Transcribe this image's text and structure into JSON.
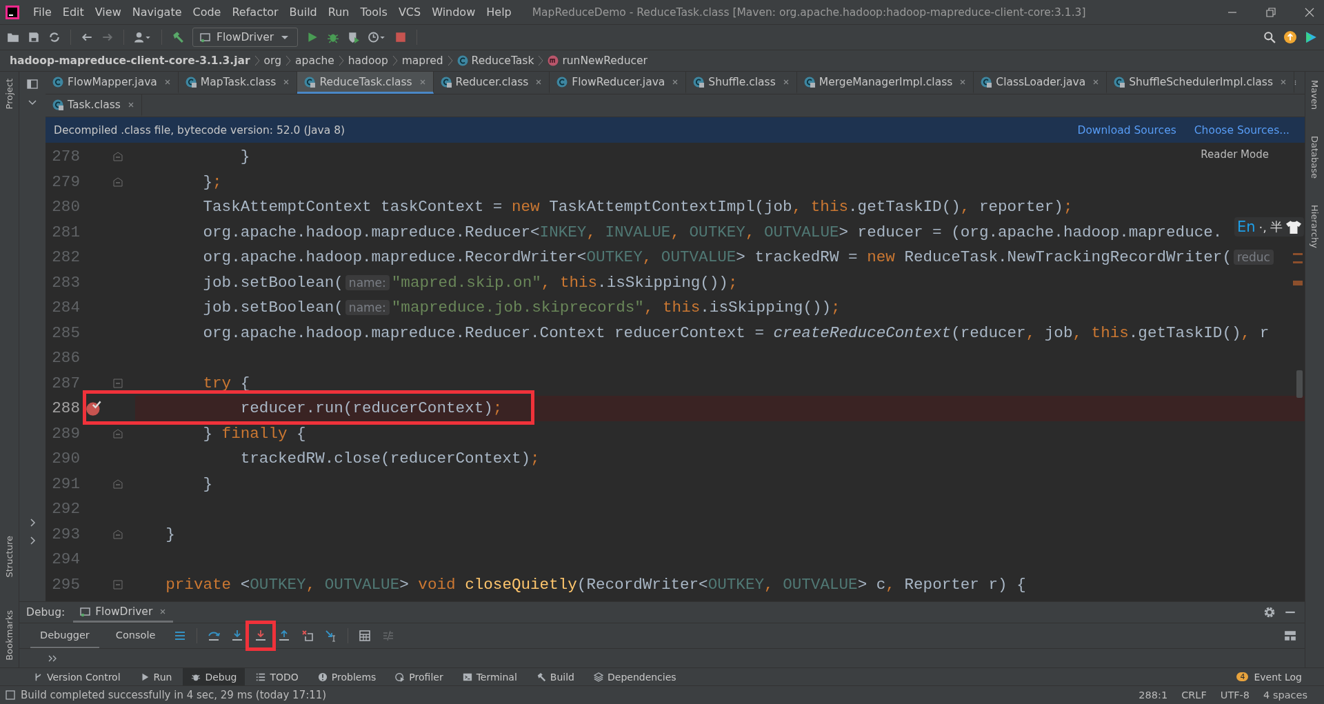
{
  "title_bar": {
    "menu": [
      "File",
      "Edit",
      "View",
      "Navigate",
      "Code",
      "Refactor",
      "Build",
      "Run",
      "Tools",
      "VCS",
      "Window",
      "Help"
    ],
    "title": "MapReduceDemo - ReduceTask.class [Maven: org.apache.hadoop:hadoop-mapreduce-client-core:3.1.3]"
  },
  "toolbar": {
    "run_config": "FlowDriver"
  },
  "breadcrumbs": [
    {
      "label": "hadoop-mapreduce-client-core-3.1.3.jar",
      "kind": "jar"
    },
    {
      "label": "org",
      "kind": "package"
    },
    {
      "label": "apache",
      "kind": "package"
    },
    {
      "label": "hadoop",
      "kind": "package"
    },
    {
      "label": "mapred",
      "kind": "package"
    },
    {
      "label": "ReduceTask",
      "kind": "class"
    },
    {
      "label": "runNewReducer",
      "kind": "method"
    }
  ],
  "tab_rows": [
    [
      {
        "label": "FlowMapper.java",
        "kind": "source",
        "selected": false
      },
      {
        "label": "MapTask.class",
        "kind": "compiled",
        "selected": false
      },
      {
        "label": "ReduceTask.class",
        "kind": "compiled",
        "selected": true
      },
      {
        "label": "Reducer.class",
        "kind": "compiled",
        "selected": false
      },
      {
        "label": "FlowReducer.java",
        "kind": "source",
        "selected": false
      },
      {
        "label": "Shuffle.class",
        "kind": "compiled",
        "selected": false
      },
      {
        "label": "MergeManagerImpl.class",
        "kind": "compiled",
        "selected": false
      },
      {
        "label": "ClassLoader.java",
        "kind": "compiled",
        "selected": false
      },
      {
        "label": "ShuffleSchedulerImpl.class",
        "kind": "compiled",
        "selected": false
      }
    ],
    [
      {
        "label": "Task.class",
        "kind": "compiled",
        "selected": false
      }
    ]
  ],
  "banner": {
    "text": "Decompiled .class file, bytecode version: 52.0 (Java 8)",
    "links": [
      "Download Sources",
      "Choose Sources..."
    ]
  },
  "editor": {
    "reader_mode": "Reader Mode",
    "lines": [
      {
        "number": "278",
        "fold_start": false,
        "fold_end": true,
        "breakpoint": false,
        "highlighted": false,
        "tokens": [
          {
            "kind": "plain",
            "text": "            }"
          }
        ]
      },
      {
        "number": "279",
        "fold_start": false,
        "fold_end": true,
        "breakpoint": false,
        "highlighted": false,
        "tokens": [
          {
            "kind": "plain",
            "text": "        }"
          },
          {
            "kind": "punct",
            "text": ";"
          }
        ]
      },
      {
        "number": "280",
        "fold_start": false,
        "fold_end": false,
        "breakpoint": false,
        "highlighted": false,
        "tokens": [
          {
            "kind": "plain",
            "text": "        TaskAttemptContext taskContext = "
          },
          {
            "kind": "keyword",
            "text": "new"
          },
          {
            "kind": "plain",
            "text": " TaskAttemptContextImpl(job"
          },
          {
            "kind": "punct",
            "text": ", "
          },
          {
            "kind": "keyword",
            "text": "this"
          },
          {
            "kind": "plain",
            "text": ".getTaskID()"
          },
          {
            "kind": "punct",
            "text": ", "
          },
          {
            "kind": "plain",
            "text": "reporter)"
          },
          {
            "kind": "punct",
            "text": ";"
          }
        ]
      },
      {
        "number": "281",
        "fold_start": false,
        "fold_end": false,
        "breakpoint": false,
        "highlighted": false,
        "tokens": [
          {
            "kind": "plain",
            "text": "        org.apache.hadoop.mapreduce.Reducer<"
          },
          {
            "kind": "typeparam",
            "text": "INKEY"
          },
          {
            "kind": "punct",
            "text": ", "
          },
          {
            "kind": "typeparam",
            "text": "INVALUE"
          },
          {
            "kind": "punct",
            "text": ", "
          },
          {
            "kind": "typeparam",
            "text": "OUTKEY"
          },
          {
            "kind": "punct",
            "text": ", "
          },
          {
            "kind": "typeparam",
            "text": "OUTVALUE"
          },
          {
            "kind": "plain",
            "text": "> reducer = (org.apache.hadoop.mapreduce."
          }
        ]
      },
      {
        "number": "282",
        "fold_start": false,
        "fold_end": false,
        "breakpoint": false,
        "highlighted": false,
        "tokens": [
          {
            "kind": "plain",
            "text": "        org.apache.hadoop.mapreduce.RecordWriter<"
          },
          {
            "kind": "typeparam",
            "text": "OUTKEY"
          },
          {
            "kind": "punct",
            "text": ", "
          },
          {
            "kind": "typeparam",
            "text": "OUTVALUE"
          },
          {
            "kind": "plain",
            "text": "> trackedRW = "
          },
          {
            "kind": "keyword",
            "text": "new"
          },
          {
            "kind": "plain",
            "text": " ReduceTask.NewTrackingRecordWriter("
          },
          {
            "kind": "hint",
            "text": "reduc"
          }
        ]
      },
      {
        "number": "283",
        "fold_start": false,
        "fold_end": false,
        "breakpoint": false,
        "highlighted": false,
        "tokens": [
          {
            "kind": "plain",
            "text": "        job.setBoolean("
          },
          {
            "kind": "hint",
            "text": "name:"
          },
          {
            "kind": "string",
            "text": "\"mapred.skip.on\""
          },
          {
            "kind": "punct",
            "text": ", "
          },
          {
            "kind": "keyword",
            "text": "this"
          },
          {
            "kind": "plain",
            "text": ".isSkipping())"
          },
          {
            "kind": "punct",
            "text": ";"
          }
        ]
      },
      {
        "number": "284",
        "fold_start": false,
        "fold_end": false,
        "breakpoint": false,
        "highlighted": false,
        "tokens": [
          {
            "kind": "plain",
            "text": "        job.setBoolean("
          },
          {
            "kind": "hint",
            "text": "name:"
          },
          {
            "kind": "string",
            "text": "\"mapreduce.job.skiprecords\""
          },
          {
            "kind": "punct",
            "text": ", "
          },
          {
            "kind": "keyword",
            "text": "this"
          },
          {
            "kind": "plain",
            "text": ".isSkipping())"
          },
          {
            "kind": "punct",
            "text": ";"
          }
        ]
      },
      {
        "number": "285",
        "fold_start": false,
        "fold_end": false,
        "breakpoint": false,
        "highlighted": false,
        "tokens": [
          {
            "kind": "plain",
            "text": "        org.apache.hadoop.mapreduce.Reducer.Context reducerContext = "
          },
          {
            "kind": "italic",
            "text": "createReduceContext"
          },
          {
            "kind": "plain",
            "text": "(reducer"
          },
          {
            "kind": "punct",
            "text": ", "
          },
          {
            "kind": "plain",
            "text": "job"
          },
          {
            "kind": "punct",
            "text": ", "
          },
          {
            "kind": "keyword",
            "text": "this"
          },
          {
            "kind": "plain",
            "text": ".getTaskID()"
          },
          {
            "kind": "punct",
            "text": ", "
          },
          {
            "kind": "plain",
            "text": "r"
          }
        ]
      },
      {
        "number": "286",
        "fold_start": false,
        "fold_end": false,
        "breakpoint": false,
        "highlighted": false
      },
      {
        "number": "287",
        "fold_start": true,
        "fold_end": false,
        "breakpoint": false,
        "highlighted": false,
        "tokens": [
          {
            "kind": "keyword",
            "text": "        try"
          },
          {
            "kind": "plain",
            "text": " {"
          }
        ]
      },
      {
        "number": "288",
        "fold_start": false,
        "fold_end": false,
        "breakpoint": true,
        "highlighted": true,
        "tokens": [
          {
            "kind": "plain",
            "text": "            reducer.run(reducerContext)"
          },
          {
            "kind": "punct",
            "text": ";"
          }
        ]
      },
      {
        "number": "289",
        "fold_start": false,
        "fold_end": true,
        "breakpoint": false,
        "highlighted": false,
        "tokens": [
          {
            "kind": "plain",
            "text": "        } "
          },
          {
            "kind": "keyword",
            "text": "finally"
          },
          {
            "kind": "plain",
            "text": " {"
          }
        ]
      },
      {
        "number": "290",
        "fold_start": false,
        "fold_end": false,
        "breakpoint": false,
        "highlighted": false,
        "tokens": [
          {
            "kind": "plain",
            "text": "            trackedRW.close(reducerContext)"
          },
          {
            "kind": "punct",
            "text": ";"
          }
        ]
      },
      {
        "number": "291",
        "fold_start": false,
        "fold_end": true,
        "breakpoint": false,
        "highlighted": false,
        "tokens": [
          {
            "kind": "plain",
            "text": "        }"
          }
        ]
      },
      {
        "number": "292",
        "fold_start": false,
        "fold_end": false,
        "breakpoint": false,
        "highlighted": false
      },
      {
        "number": "293",
        "fold_start": false,
        "fold_end": true,
        "breakpoint": false,
        "highlighted": false,
        "tokens": [
          {
            "kind": "plain",
            "text": "    }"
          }
        ]
      },
      {
        "number": "294",
        "fold_start": false,
        "fold_end": false,
        "breakpoint": false,
        "highlighted": false
      },
      {
        "number": "295",
        "fold_start": true,
        "fold_end": false,
        "breakpoint": false,
        "highlighted": false,
        "tokens": [
          {
            "kind": "keyword",
            "text": "    private"
          },
          {
            "kind": "plain",
            "text": " <"
          },
          {
            "kind": "typeparam",
            "text": "OUTKEY"
          },
          {
            "kind": "punct",
            "text": ", "
          },
          {
            "kind": "typeparam",
            "text": "OUTVALUE"
          },
          {
            "kind": "plain",
            "text": "> "
          },
          {
            "kind": "keyword",
            "text": "void "
          },
          {
            "kind": "method",
            "text": "closeQuietly"
          },
          {
            "kind": "plain",
            "text": "(RecordWriter<"
          },
          {
            "kind": "typeparam",
            "text": "OUTKEY"
          },
          {
            "kind": "punct",
            "text": ", "
          },
          {
            "kind": "typeparam",
            "text": "OUTVALUE"
          },
          {
            "kind": "plain",
            "text": "> c"
          },
          {
            "kind": "punct",
            "text": ", "
          },
          {
            "kind": "plain",
            "text": "Reporter r) {"
          }
        ]
      }
    ]
  },
  "ime": {
    "mode": "En",
    "punctuation": "·,",
    "width": "半"
  },
  "left_stripe": {
    "top": [
      {
        "label": "Project"
      }
    ],
    "bottom": [
      {
        "label": "Structure"
      },
      {
        "label": "Bookmarks"
      }
    ]
  },
  "right_stripe": [
    {
      "label": "Maven"
    },
    {
      "label": "Database"
    },
    {
      "label": "Hierarchy"
    }
  ],
  "debug": {
    "label": "Debug:",
    "session": {
      "label": "FlowDriver",
      "selected": true
    },
    "tabs": [
      {
        "label": "Debugger",
        "selected": true
      },
      {
        "label": "Console",
        "selected": false
      }
    ],
    "toolbar": [
      {
        "kind": "frames",
        "highlighted": false
      },
      {
        "kind": "step-over",
        "highlighted": false
      },
      {
        "kind": "step-into",
        "highlighted": false
      },
      {
        "kind": "force-step-into",
        "highlighted": true
      },
      {
        "kind": "step-out",
        "highlighted": false
      },
      {
        "kind": "drop-frame",
        "highlighted": false
      },
      {
        "kind": "run-to-cursor",
        "highlighted": false
      },
      {
        "kind": "evaluate",
        "highlighted": false
      },
      {
        "kind": "trace",
        "highlighted": false
      }
    ]
  },
  "tool_windows": [
    {
      "label": "Version Control",
      "kind": "vcs",
      "selected": false
    },
    {
      "label": "Run",
      "kind": "run",
      "selected": false
    },
    {
      "label": "Debug",
      "kind": "debug",
      "selected": true
    },
    {
      "label": "TODO",
      "kind": "todo",
      "selected": false
    },
    {
      "label": "Problems",
      "kind": "problems",
      "selected": false
    },
    {
      "label": "Profiler",
      "kind": "profiler",
      "selected": false
    },
    {
      "label": "Terminal",
      "kind": "terminal",
      "selected": false
    },
    {
      "label": "Build",
      "kind": "build",
      "selected": false
    },
    {
      "label": "Dependencies",
      "kind": "dependencies",
      "selected": false
    }
  ],
  "event_log": {
    "label": "Event Log",
    "count": "4"
  },
  "status_bar": {
    "message": "Build completed successfully in 4 sec, 29 ms (today 17:11)",
    "items": [
      "288:1",
      "CRLF",
      "UTF-8",
      "4 spaces"
    ]
  }
}
